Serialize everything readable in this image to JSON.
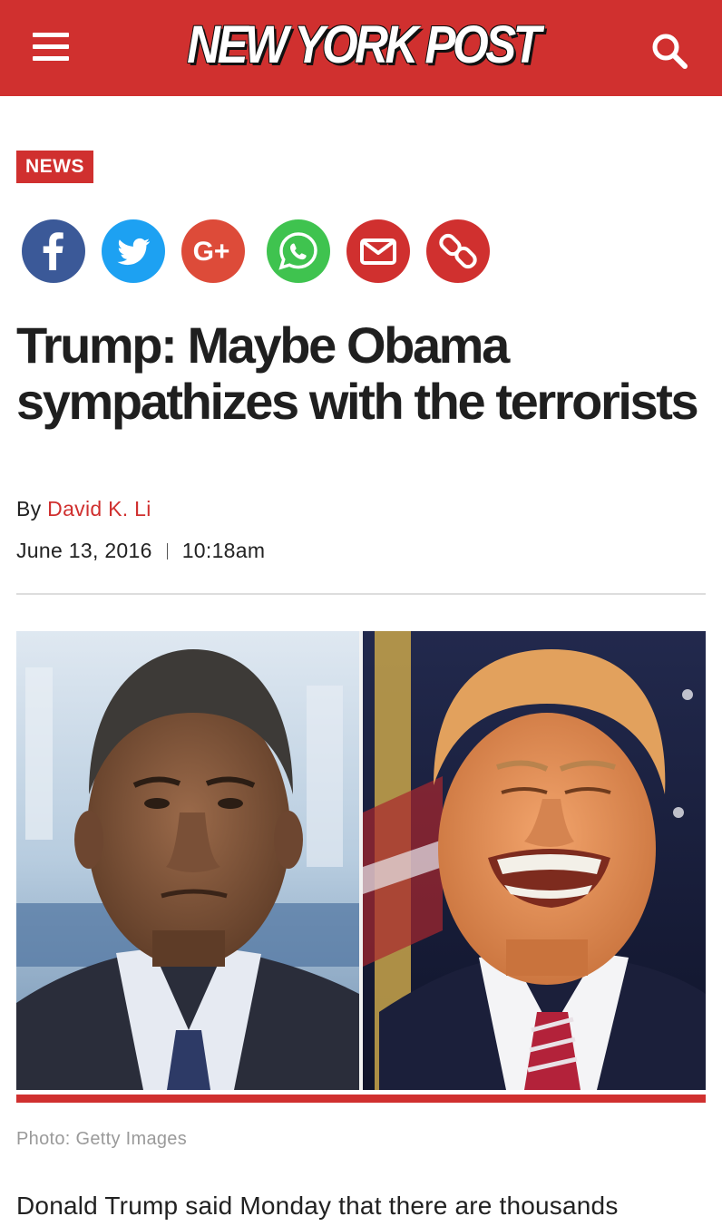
{
  "header": {
    "logo_text": "NEW YORK POST",
    "menu_icon": "hamburger-menu-icon",
    "search_icon": "search-icon",
    "brand_color": "#d0302f"
  },
  "article": {
    "section_tag": "NEWS",
    "headline": "Trump: Maybe Obama sympathizes with the terrorists",
    "byline_prefix": "By",
    "author": "David K. Li",
    "date": "June 13, 2016",
    "time": "10:18am",
    "photo_caption": "Photo: Getty Images",
    "body_first_line": "Donald Trump said Monday that there are thousands"
  },
  "share_buttons": [
    {
      "name": "facebook",
      "icon": "facebook-icon",
      "color": "#3b5998"
    },
    {
      "name": "twitter",
      "icon": "twitter-icon",
      "color": "#1da1f2"
    },
    {
      "name": "google-plus",
      "icon": "google-plus-icon",
      "color": "#dd4b39"
    },
    {
      "name": "whatsapp",
      "icon": "whatsapp-icon",
      "color": "#3fc34f"
    },
    {
      "name": "email",
      "icon": "email-icon",
      "color": "#d0302f"
    },
    {
      "name": "copy-link",
      "icon": "link-icon",
      "color": "#d0302f"
    }
  ]
}
